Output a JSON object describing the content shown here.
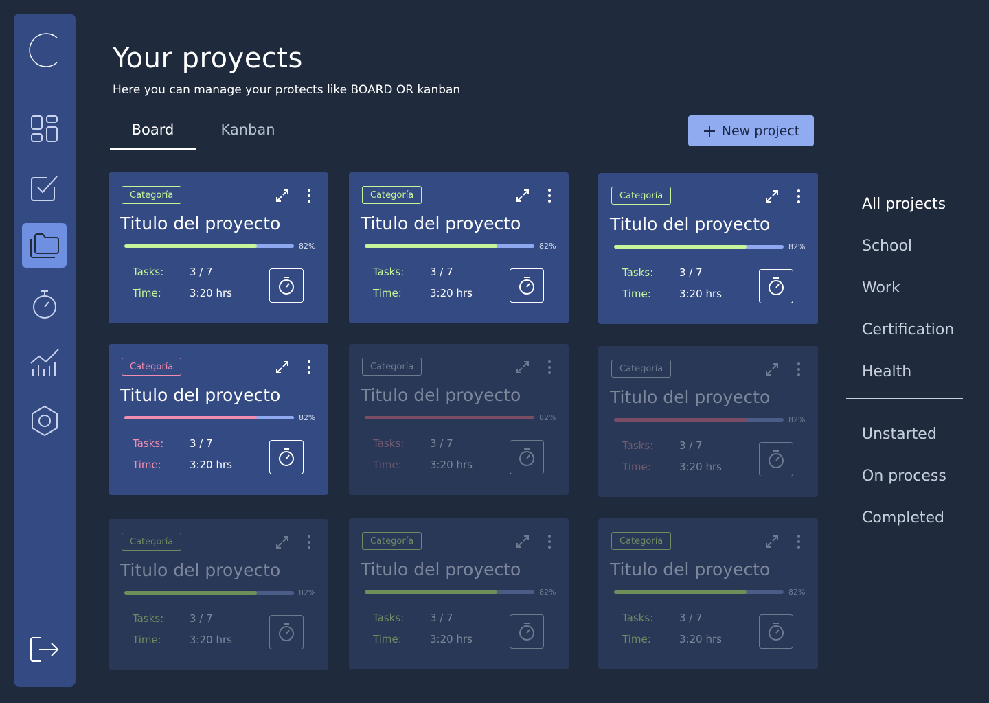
{
  "header": {
    "title": "Your proyects",
    "subtitle": "Here you can manage your protects like BOARD OR kanban"
  },
  "tabs": [
    {
      "label": "Board",
      "active": true
    },
    {
      "label": "Kanban",
      "active": false
    }
  ],
  "new_project_label": "New project",
  "sidebar": {
    "items": [
      "dashboard-icon",
      "tasks-icon",
      "projects-icon",
      "timer-icon",
      "stats-icon",
      "settings-icon"
    ],
    "active": "projects-icon",
    "logout": "logout-icon"
  },
  "cards": [
    {
      "category": "Categoría",
      "title": "Titulo del proyecto",
      "progress": 0.78,
      "progress_label": "82%",
      "tasks_label": "Tasks:",
      "tasks_value": "3 / 7",
      "time_label": "Time:",
      "time_value": "3:20 hrs",
      "variant": "green",
      "state": "normal"
    },
    {
      "category": "Categoría",
      "title": "Titulo del proyecto",
      "progress": 0.78,
      "progress_label": "82%",
      "tasks_label": "Tasks:",
      "tasks_value": "3 / 7",
      "time_label": "Time:",
      "time_value": "3:20 hrs",
      "variant": "green",
      "state": "normal"
    },
    {
      "category": "Categoría",
      "title": "Titulo del proyecto",
      "progress": 0.78,
      "progress_label": "82%",
      "tasks_label": "Tasks:",
      "tasks_value": "3 / 7",
      "time_label": "Time:",
      "time_value": "3:20 hrs",
      "variant": "green",
      "state": "normal"
    },
    {
      "category": "Categoría",
      "title": "Titulo del proyecto",
      "progress": 0.78,
      "progress_label": "82%",
      "tasks_label": "Tasks:",
      "tasks_value": "3 / 7",
      "time_label": "Time:",
      "time_value": "3:20 hrs",
      "variant": "pink",
      "state": "normal"
    },
    {
      "category": "Categoría",
      "title": "Titulo del proyecto",
      "progress": 1.0,
      "progress_label": "82%",
      "tasks_label": "Tasks:",
      "tasks_value": "3 / 7",
      "time_label": "Time:",
      "time_value": "3:20 hrs",
      "variant": "pink",
      "state": "dim"
    },
    {
      "category": "Categoría",
      "title": "Titulo del proyecto",
      "progress": 0.78,
      "progress_label": "82%",
      "tasks_label": "Tasks:",
      "tasks_value": "3 / 7",
      "time_label": "Time:",
      "time_value": "3:20 hrs",
      "variant": "pink",
      "state": "dim"
    },
    {
      "category": "Categoría",
      "title": "Titulo del proyecto",
      "progress": 0.78,
      "progress_label": "82%",
      "tasks_label": "Tasks:",
      "tasks_value": "3 / 7",
      "time_label": "Time:",
      "time_value": "3:20 hrs",
      "variant": "green",
      "state": "dim"
    },
    {
      "category": "Categoría",
      "title": "Titulo del proyecto",
      "progress": 0.78,
      "progress_label": "82%",
      "tasks_label": "Tasks:",
      "tasks_value": "3 / 7",
      "time_label": "Time:",
      "time_value": "3:20 hrs",
      "variant": "green",
      "state": "dim"
    },
    {
      "category": "Categoría",
      "title": "Titulo del proyecto",
      "progress": 0.78,
      "progress_label": "82%",
      "tasks_label": "Tasks:",
      "tasks_value": "3 / 7",
      "time_label": "Time:",
      "time_value": "3:20 hrs",
      "variant": "green",
      "state": "dim"
    }
  ],
  "filters": {
    "groups": [
      [
        "All projects",
        "School",
        "Work",
        "Certification",
        "Health"
      ],
      [
        "Unstarted",
        "On process",
        "Completed"
      ]
    ],
    "active": "All projects"
  },
  "colors": {
    "background": "#1f2a3c",
    "sidebar": "#344a82",
    "card": "#344a82",
    "accent_green": "#c7f39a",
    "accent_pink": "#f28cb1",
    "button": "#91abf0"
  }
}
